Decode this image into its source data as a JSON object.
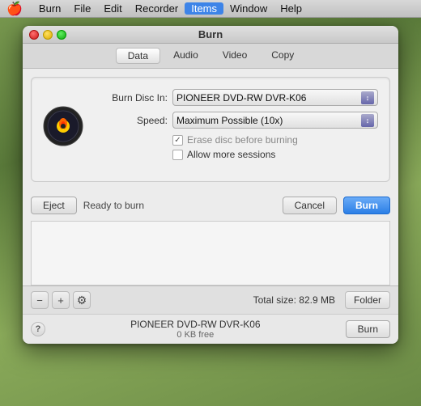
{
  "menubar": {
    "apple": "🍎",
    "items": [
      {
        "label": "Burn",
        "active": false
      },
      {
        "label": "File",
        "active": false
      },
      {
        "label": "Edit",
        "active": false
      },
      {
        "label": "Recorder",
        "active": false
      },
      {
        "label": "Items",
        "active": true
      },
      {
        "label": "Window",
        "active": false
      },
      {
        "label": "Help",
        "active": false
      }
    ]
  },
  "window": {
    "title": "Burn"
  },
  "toolbar": {
    "tabs": [
      {
        "label": "Data",
        "active": true
      },
      {
        "label": "Audio",
        "active": false
      },
      {
        "label": "Video",
        "active": false
      },
      {
        "label": "Copy",
        "active": false
      }
    ]
  },
  "dialog": {
    "burn_disc_label": "Burn Disc In:",
    "burn_disc_value": "PIONEER DVD-RW DVR-K06",
    "speed_label": "Speed:",
    "speed_value": "Maximum Possible (10x)",
    "erase_label": "Erase disc before burning",
    "sessions_label": "Allow more sessions",
    "erase_checked": true,
    "sessions_checked": false
  },
  "buttons": {
    "eject": "Eject",
    "status": "Ready to burn",
    "cancel": "Cancel",
    "burn": "Burn"
  },
  "bottom_toolbar": {
    "minus": "−",
    "plus": "+",
    "gear": "⚙",
    "total_size_label": "Total size:",
    "total_size_value": "82.9 MB",
    "folder": "Folder"
  },
  "status_bar": {
    "help": "?",
    "drive": "PIONEER DVD-RW DVR-K06",
    "free": "0 KB free",
    "burn": "Burn"
  }
}
